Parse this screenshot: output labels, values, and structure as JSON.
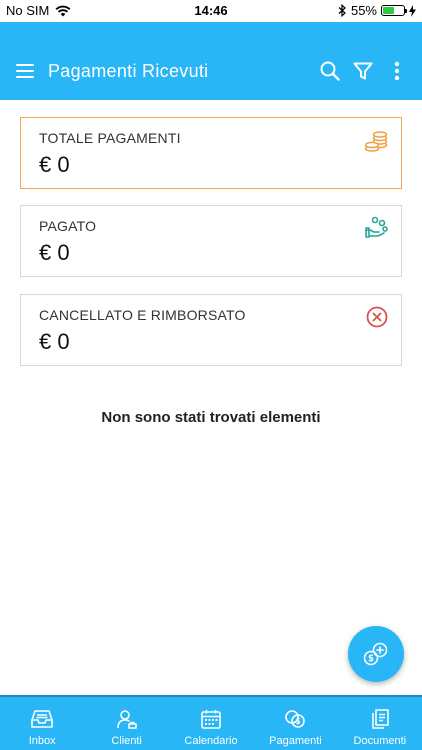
{
  "status_bar": {
    "carrier": "No SIM",
    "time": "14:46",
    "battery_percent": "55%",
    "battery_level": 0.55
  },
  "header": {
    "title": "Pagamenti Ricevuti",
    "menu_icon": "hamburger-menu-icon",
    "search_icon": "search-icon",
    "filter_icon": "filter-icon",
    "more_icon": "more-vertical-icon"
  },
  "cards": [
    {
      "label": "TOTALE PAGAMENTI",
      "value": "€ 0",
      "icon": "coins-stack-icon",
      "icon_color": "#f0a040",
      "border_color": "#f2a65a"
    },
    {
      "label": "PAGATO",
      "value": "€ 0",
      "icon": "hand-coins-icon",
      "icon_color": "#26a69a"
    },
    {
      "label": "CANCELLATO E RIMBORSATO",
      "value": "€ 0",
      "icon": "cancel-circle-icon",
      "icon_color": "#d9534f"
    }
  ],
  "empty_message": "Non sono stati trovati elementi",
  "fab": {
    "icon": "add-payment-icon"
  },
  "nav": [
    {
      "label": "Inbox",
      "icon": "inbox-icon"
    },
    {
      "label": "Clienti",
      "icon": "clients-icon"
    },
    {
      "label": "Calendario",
      "icon": "calendar-icon"
    },
    {
      "label": "Pagamenti",
      "icon": "payments-icon"
    },
    {
      "label": "Documenti",
      "icon": "documents-icon"
    }
  ],
  "colors": {
    "primary": "#29b6f6",
    "accent_orange": "#f0a040",
    "accent_green": "#26a69a",
    "accent_red": "#d9534f"
  }
}
